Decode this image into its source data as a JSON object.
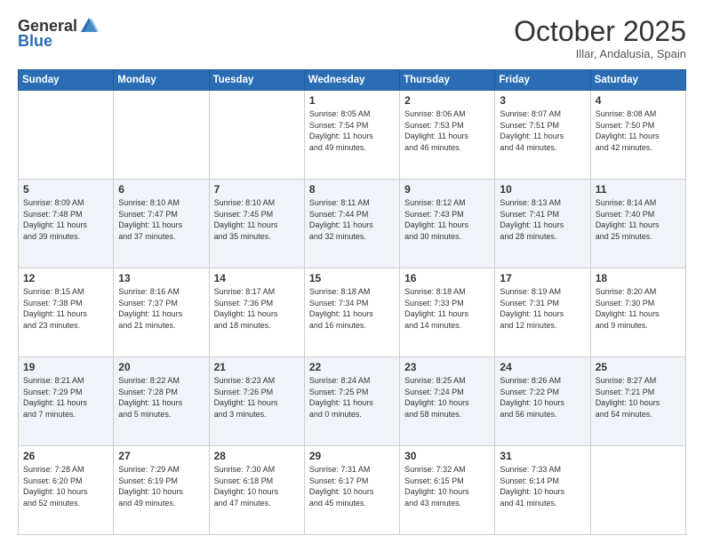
{
  "header": {
    "logo_general": "General",
    "logo_blue": "Blue",
    "month": "October 2025",
    "location": "Illar, Andalusia, Spain"
  },
  "weekdays": [
    "Sunday",
    "Monday",
    "Tuesday",
    "Wednesday",
    "Thursday",
    "Friday",
    "Saturday"
  ],
  "weeks": [
    [
      {
        "day": "",
        "info": ""
      },
      {
        "day": "",
        "info": ""
      },
      {
        "day": "",
        "info": ""
      },
      {
        "day": "1",
        "info": "Sunrise: 8:05 AM\nSunset: 7:54 PM\nDaylight: 11 hours\nand 49 minutes."
      },
      {
        "day": "2",
        "info": "Sunrise: 8:06 AM\nSunset: 7:53 PM\nDaylight: 11 hours\nand 46 minutes."
      },
      {
        "day": "3",
        "info": "Sunrise: 8:07 AM\nSunset: 7:51 PM\nDaylight: 11 hours\nand 44 minutes."
      },
      {
        "day": "4",
        "info": "Sunrise: 8:08 AM\nSunset: 7:50 PM\nDaylight: 11 hours\nand 42 minutes."
      }
    ],
    [
      {
        "day": "5",
        "info": "Sunrise: 8:09 AM\nSunset: 7:48 PM\nDaylight: 11 hours\nand 39 minutes."
      },
      {
        "day": "6",
        "info": "Sunrise: 8:10 AM\nSunset: 7:47 PM\nDaylight: 11 hours\nand 37 minutes."
      },
      {
        "day": "7",
        "info": "Sunrise: 8:10 AM\nSunset: 7:45 PM\nDaylight: 11 hours\nand 35 minutes."
      },
      {
        "day": "8",
        "info": "Sunrise: 8:11 AM\nSunset: 7:44 PM\nDaylight: 11 hours\nand 32 minutes."
      },
      {
        "day": "9",
        "info": "Sunrise: 8:12 AM\nSunset: 7:43 PM\nDaylight: 11 hours\nand 30 minutes."
      },
      {
        "day": "10",
        "info": "Sunrise: 8:13 AM\nSunset: 7:41 PM\nDaylight: 11 hours\nand 28 minutes."
      },
      {
        "day": "11",
        "info": "Sunrise: 8:14 AM\nSunset: 7:40 PM\nDaylight: 11 hours\nand 25 minutes."
      }
    ],
    [
      {
        "day": "12",
        "info": "Sunrise: 8:15 AM\nSunset: 7:38 PM\nDaylight: 11 hours\nand 23 minutes."
      },
      {
        "day": "13",
        "info": "Sunrise: 8:16 AM\nSunset: 7:37 PM\nDaylight: 11 hours\nand 21 minutes."
      },
      {
        "day": "14",
        "info": "Sunrise: 8:17 AM\nSunset: 7:36 PM\nDaylight: 11 hours\nand 18 minutes."
      },
      {
        "day": "15",
        "info": "Sunrise: 8:18 AM\nSunset: 7:34 PM\nDaylight: 11 hours\nand 16 minutes."
      },
      {
        "day": "16",
        "info": "Sunrise: 8:18 AM\nSunset: 7:33 PM\nDaylight: 11 hours\nand 14 minutes."
      },
      {
        "day": "17",
        "info": "Sunrise: 8:19 AM\nSunset: 7:31 PM\nDaylight: 11 hours\nand 12 minutes."
      },
      {
        "day": "18",
        "info": "Sunrise: 8:20 AM\nSunset: 7:30 PM\nDaylight: 11 hours\nand 9 minutes."
      }
    ],
    [
      {
        "day": "19",
        "info": "Sunrise: 8:21 AM\nSunset: 7:29 PM\nDaylight: 11 hours\nand 7 minutes."
      },
      {
        "day": "20",
        "info": "Sunrise: 8:22 AM\nSunset: 7:28 PM\nDaylight: 11 hours\nand 5 minutes."
      },
      {
        "day": "21",
        "info": "Sunrise: 8:23 AM\nSunset: 7:26 PM\nDaylight: 11 hours\nand 3 minutes."
      },
      {
        "day": "22",
        "info": "Sunrise: 8:24 AM\nSunset: 7:25 PM\nDaylight: 11 hours\nand 0 minutes."
      },
      {
        "day": "23",
        "info": "Sunrise: 8:25 AM\nSunset: 7:24 PM\nDaylight: 10 hours\nand 58 minutes."
      },
      {
        "day": "24",
        "info": "Sunrise: 8:26 AM\nSunset: 7:22 PM\nDaylight: 10 hours\nand 56 minutes."
      },
      {
        "day": "25",
        "info": "Sunrise: 8:27 AM\nSunset: 7:21 PM\nDaylight: 10 hours\nand 54 minutes."
      }
    ],
    [
      {
        "day": "26",
        "info": "Sunrise: 7:28 AM\nSunset: 6:20 PM\nDaylight: 10 hours\nand 52 minutes."
      },
      {
        "day": "27",
        "info": "Sunrise: 7:29 AM\nSunset: 6:19 PM\nDaylight: 10 hours\nand 49 minutes."
      },
      {
        "day": "28",
        "info": "Sunrise: 7:30 AM\nSunset: 6:18 PM\nDaylight: 10 hours\nand 47 minutes."
      },
      {
        "day": "29",
        "info": "Sunrise: 7:31 AM\nSunset: 6:17 PM\nDaylight: 10 hours\nand 45 minutes."
      },
      {
        "day": "30",
        "info": "Sunrise: 7:32 AM\nSunset: 6:15 PM\nDaylight: 10 hours\nand 43 minutes."
      },
      {
        "day": "31",
        "info": "Sunrise: 7:33 AM\nSunset: 6:14 PM\nDaylight: 10 hours\nand 41 minutes."
      },
      {
        "day": "",
        "info": ""
      }
    ]
  ]
}
